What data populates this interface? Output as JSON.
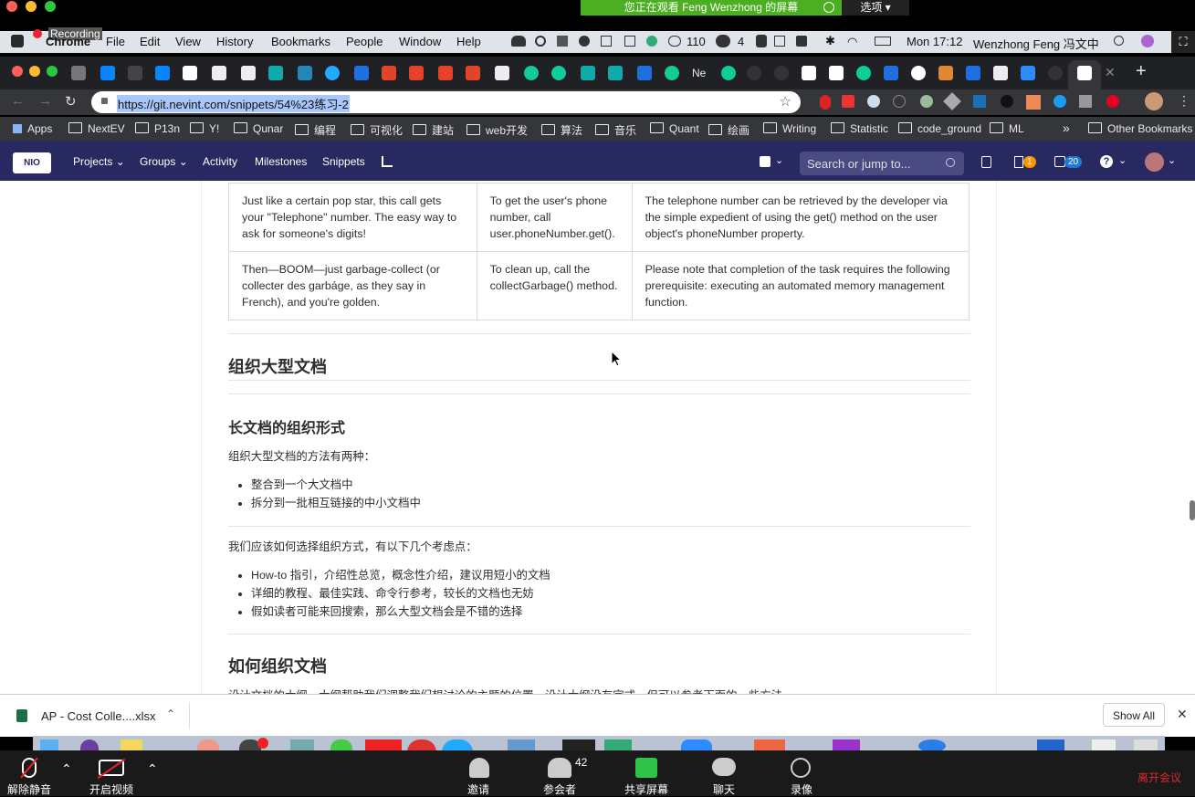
{
  "zoom": {
    "share_banner": "您正在观看 Feng Wenzhong 的屏幕",
    "options": "选项",
    "recording": "Recording",
    "bottom": {
      "unmute": "解除静音",
      "start_video": "开启视频",
      "invite": "邀请",
      "participants": "参会者",
      "participants_count": "42",
      "share_screen": "共享屏幕",
      "chat": "聊天",
      "record": "录像",
      "leave": "离开会议"
    }
  },
  "menubar": {
    "app": "Chrome",
    "items": [
      "File",
      "Edit",
      "View",
      "History",
      "Bookmarks",
      "People",
      "Window",
      "Help"
    ],
    "status_count_1": "110",
    "status_count_2": "4",
    "clock": "Mon 17:12",
    "user": "Wenzhong Feng 冯文中"
  },
  "tabs": {
    "active_label": "Ne"
  },
  "address": {
    "url": "https://git.nevint.com/snippets/54%23练习-2"
  },
  "bookmarks": {
    "apps": "Apps",
    "items": [
      "NextEV",
      "P13n",
      "Y!",
      "Qunar",
      "编程",
      "可视化",
      "建站",
      "web开发",
      "算法",
      "音乐",
      "Quant",
      "绘画",
      "Writing",
      "Statistic",
      "code_ground",
      "ML"
    ],
    "more": "»",
    "other": "Other Bookmarks"
  },
  "gitlab": {
    "logo": "NIO",
    "nav": [
      "Projects",
      "Groups",
      "Activity",
      "Milestones",
      "Snippets"
    ],
    "search_placeholder": "Search or jump to...",
    "mr_count": "1",
    "todo_count": "20"
  },
  "doc": {
    "table_rows": [
      [
        "Just like a certain pop star, this call gets your \"Telephone\" number. The easy way to ask for someone's digits!",
        "To get the user's phone number, call user.phoneNumber.get().",
        "The telephone number can be retrieved by the developer via the simple expedient of using the get() method on the user object's phoneNumber property."
      ],
      [
        "Then—BOOM—just garbage-collect (or collecter des garbáge, as they say in French), and you're golden.",
        "To clean up, call the collectGarbage() method.",
        "Please note that completion of the task requires the following prerequisite: executing an automated memory management function."
      ]
    ],
    "h2_1": "组织大型文档",
    "h3_1": "长文档的组织形式",
    "p1": "组织大型文档的方法有两种：",
    "list1": [
      "整合到一个大文档中",
      "拆分到一批相互链接的中小文档中"
    ],
    "p2": "我们应该如何选择组织方式，有以下几个考虑点：",
    "list2": [
      "How-to 指引，介绍性总览，概念性介绍，建议用短小的文档",
      "详细的教程、最佳实践、命令行参考，较长的文档也无妨",
      "假如读者可能来回搜索，那么大型文档会是不错的选择"
    ],
    "h2_2": "如何组织文档",
    "p3_cut": "设计文档的大纲，大纲帮助我们调整我们想讨论的主题的位置，设计大纲没有定式，但可以参考下面的一些方法"
  },
  "download": {
    "file": "AP - Cost Colle....xlsx",
    "show_all": "Show All"
  },
  "colors": {
    "gitlab_nav": "#292961",
    "zoom_green": "#4caf22",
    "leave_red": "#e02828"
  }
}
